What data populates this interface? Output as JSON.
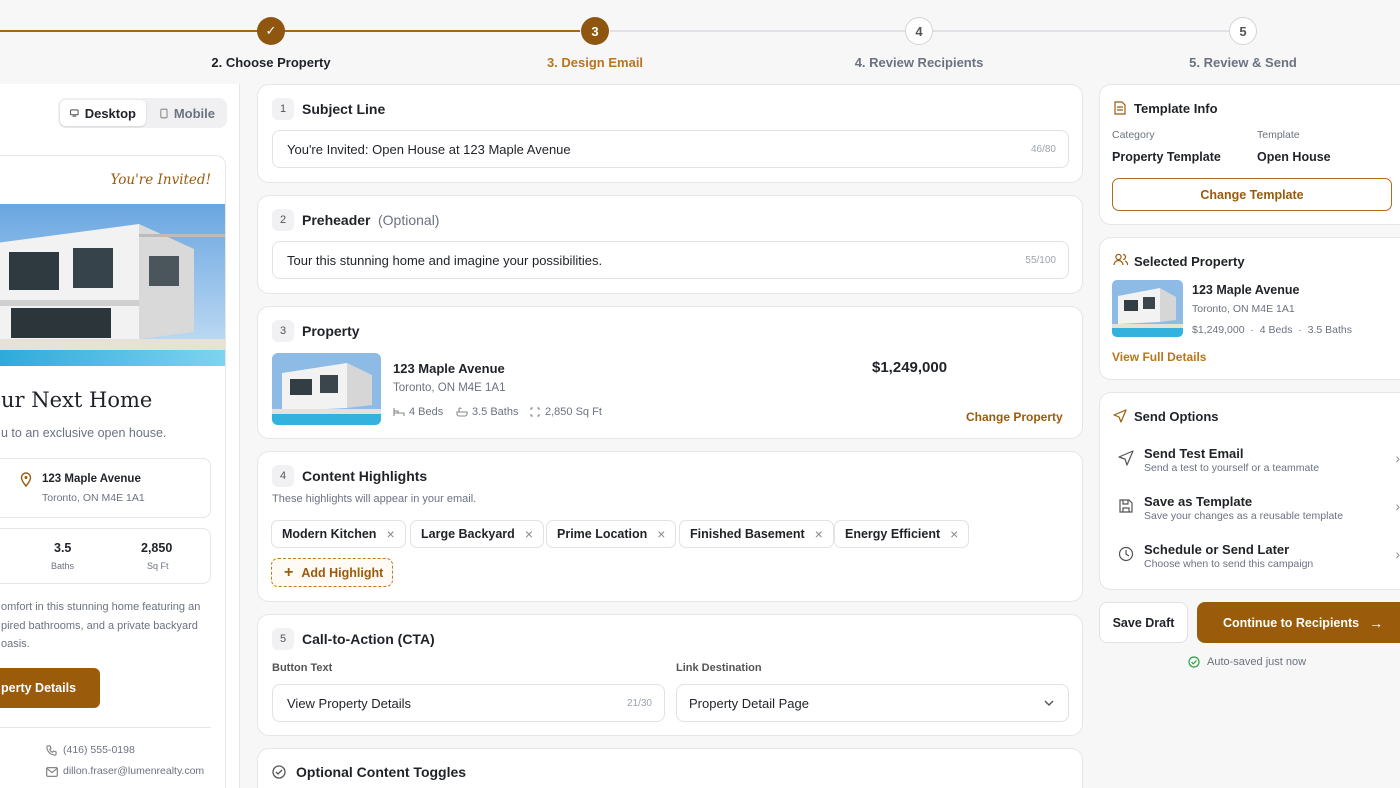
{
  "stepper": {
    "steps": [
      {
        "num": "✓",
        "label": "2. Choose Property",
        "state": "done"
      },
      {
        "num": "3",
        "label": "3. Design Email",
        "state": "active"
      },
      {
        "num": "4",
        "label": "4. Review Recipients",
        "state": "todo"
      },
      {
        "num": "5",
        "label": "5. Review & Send",
        "state": "todo"
      }
    ]
  },
  "preview": {
    "desktop_label": "Desktop",
    "mobile_label": "Mobile",
    "invited": "You're Invited!",
    "headline": "ur Next Home",
    "subline": "u to an exclusive open house.",
    "address": "123 Maple Avenue",
    "city": "Toronto, ON M4E 1A1",
    "stat_baths_value": "3.5",
    "stat_baths_label": "Baths",
    "stat_sqft_value": "2,850",
    "stat_sqft_label": "Sq Ft",
    "body_l1": "omfort in this stunning home featuring an",
    "body_l2": "pired bathrooms, and a private backyard",
    "body_l3": "oasis.",
    "cta": "perty Details",
    "phone": "(416) 555-0198",
    "email": "dillon.fraser@lumenrealty.com"
  },
  "subject": {
    "num": "1",
    "title": "Subject Line",
    "value": "You're Invited: Open House at 123 Maple Avenue",
    "counter": "46/80"
  },
  "preheader": {
    "num": "2",
    "title": "Preheader",
    "optional": "(Optional)",
    "value": "Tour this stunning home and imagine your possibilities.",
    "counter": "55/100"
  },
  "property": {
    "num": "3",
    "title": "Property",
    "name": "123 Maple Avenue",
    "city": "Toronto, ON M4E 1A1",
    "beds": "4 Beds",
    "baths": "3.5 Baths",
    "sqft": "2,850 Sq Ft",
    "price": "$1,249,000",
    "change": "Change Property"
  },
  "highlights": {
    "num": "4",
    "title": "Content Highlights",
    "hint": "These highlights will appear in your email.",
    "chips": [
      "Modern Kitchen",
      "Large Backyard",
      "Prime Location",
      "Finished Basement",
      "Energy Efficient"
    ],
    "add": "Add Highlight"
  },
  "cta": {
    "num": "5",
    "title": "Call-to-Action (CTA)",
    "button_text_label": "Button Text",
    "button_text_value": "View Property Details",
    "counter": "21/30",
    "link_label": "Link Destination",
    "link_value": "Property Detail Page"
  },
  "toggles": {
    "title": "Optional Content Toggles"
  },
  "template_info": {
    "title": "Template Info",
    "category_label": "Category",
    "category_value": "Property Template",
    "template_label": "Template",
    "template_value": "Open House",
    "change": "Change Template"
  },
  "selected_property": {
    "title": "Selected Property",
    "name": "123 Maple Avenue",
    "city": "Toronto, ON M4E 1A1",
    "price": "$1,249,000",
    "beds": "4 Beds",
    "baths": "3.5 Baths",
    "view": "View Full Details"
  },
  "send_options": {
    "title": "Send Options",
    "items": [
      {
        "title": "Send Test Email",
        "sub": "Send a test to yourself or a teammate"
      },
      {
        "title": "Save as Template",
        "sub": "Save your changes as a reusable template"
      },
      {
        "title": "Schedule or Send Later",
        "sub": "Choose when to send this campaign"
      }
    ]
  },
  "actions": {
    "save_draft": "Save Draft",
    "continue": "Continue to Recipients",
    "autosaved": "Auto-saved just now"
  },
  "colors": {
    "accent": "#9a5b0b",
    "accent_text": "#b8751a"
  }
}
